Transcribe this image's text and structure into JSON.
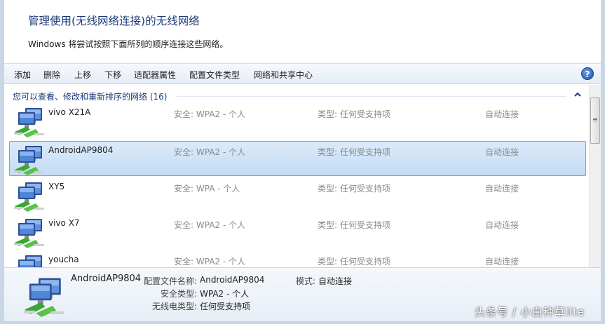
{
  "header": {
    "title": "管理使用(无线网络连接)的无线网络",
    "subtitle": "Windows 将尝试按照下面所列的顺序连接这些网络。"
  },
  "toolbar": {
    "add": "添加",
    "remove": "删除",
    "move_up": "上移",
    "move_down": "下移",
    "adapter_properties": "适配器属性",
    "profile_types": "配置文件类型",
    "network_sharing_center": "网络和共享中心",
    "help": "?"
  },
  "list": {
    "group_header": "您可以查看、修改和重新排序的网络 (16)",
    "networks": [
      {
        "name": "vivo X21A",
        "security": "安全: WPA2 - 个人",
        "type": "类型: 任何受支持项",
        "mode": "自动连接",
        "selected": false
      },
      {
        "name": "AndroidAP9804",
        "security": "安全: WPA2 - 个人",
        "type": "类型: 任何受支持项",
        "mode": "自动连接",
        "selected": true
      },
      {
        "name": "XY5",
        "security": "安全: WPA - 个人",
        "type": "类型: 任何受支持项",
        "mode": "自动连接",
        "selected": false
      },
      {
        "name": "vivo X7",
        "security": "安全: WPA2 - 个人",
        "type": "类型: 任何受支持项",
        "mode": "自动连接",
        "selected": false
      },
      {
        "name": "youcha",
        "security": "安全: WPA2 - 个人",
        "type": "类型: 任何受支持项",
        "mode": "自动连接",
        "selected": false
      }
    ]
  },
  "details": {
    "name": "AndroidAP9804",
    "profile_name_label": "配置文件名称:",
    "profile_name_value": "AndroidAP9804",
    "mode_label": "模式:",
    "mode_value": "自动连接",
    "security_type_label": "安全类型:",
    "security_type_value": "WPA2 - 个人",
    "radio_type_label": "无线电类型:",
    "radio_type_value": "任何受支持项"
  },
  "watermark": "头条号 / 小白种草lite",
  "colors": {
    "title": "#1c3a78",
    "selection": "#c4dcf5",
    "selection_border": "#7da2ce",
    "muted_text": "#8a8a8a"
  },
  "icons": {
    "network": "wireless-network-monitor-icon",
    "help": "help-icon",
    "collapse": "chevron-up-icon"
  }
}
